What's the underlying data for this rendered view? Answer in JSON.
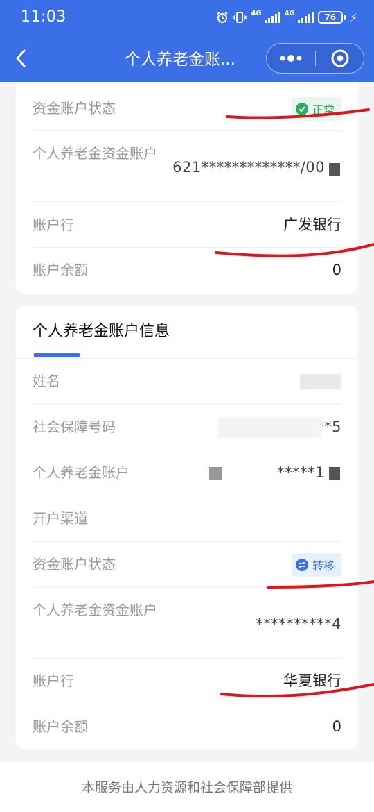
{
  "status_bar": {
    "time": "11:03",
    "battery": "76",
    "network_1": "4G",
    "network_2": "4G"
  },
  "nav": {
    "title": "个人养老金账..."
  },
  "card1": {
    "rows": [
      {
        "label": "资金账户状态",
        "badge": "正常"
      },
      {
        "label": "个人养老金资金账户",
        "value": "621*************/00"
      },
      {
        "label": "账户行",
        "value": "广发银行"
      },
      {
        "label": "账户余额",
        "value": "0"
      }
    ]
  },
  "card2": {
    "title": "个人养老金账户信息",
    "rows": [
      {
        "label": "姓名",
        "value": ""
      },
      {
        "label": "社会保障号码",
        "value": "*************5"
      },
      {
        "label": "个人养老金账户",
        "value": "*****1"
      },
      {
        "label": "开户渠道",
        "value": ""
      },
      {
        "label": "资金账户状态",
        "badge": "转移"
      },
      {
        "label": "个人养老金资金账户",
        "value": "**********4"
      },
      {
        "label": "账户行",
        "value": "华夏银行"
      },
      {
        "label": "账户余额",
        "value": "0"
      }
    ]
  },
  "footer": {
    "text": "本服务由人力资源和社会保障部提供"
  },
  "colors": {
    "brand_blue": "#3b6fe8",
    "status_green": "#27ae60",
    "annotation_red": "#e0141b"
  }
}
